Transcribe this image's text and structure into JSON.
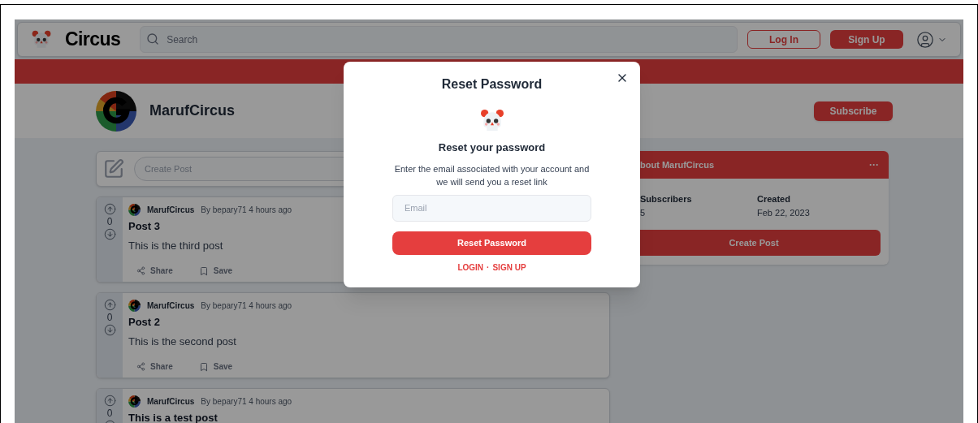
{
  "navbar": {
    "logo": "Circus",
    "search": {
      "placeholder": "Search"
    },
    "buttons": [
      "Log In",
      "Sign Up"
    ]
  },
  "community": {
    "name": "MarufCircus",
    "subscribe": "Subscribe"
  },
  "create_post": {
    "placeholder": "Create Post"
  },
  "posts": [
    {
      "votes": "0",
      "community": "MarufCircus",
      "meta": "By bepary71 4 hours ago",
      "title": "Post 3",
      "body": "This is the third post",
      "actions": [
        "Share",
        "Save"
      ]
    },
    {
      "votes": "0",
      "community": "MarufCircus",
      "meta": "By bepary71 4 hours ago",
      "title": "Post 2",
      "body": "This is the second post",
      "actions": [
        "Share",
        "Save"
      ]
    },
    {
      "votes": "0",
      "community": "MarufCircus",
      "meta": "By bepary71 4 hours ago",
      "title": "This is a test post"
    }
  ],
  "about": {
    "title": "bout MarufCircus",
    "more": "···",
    "stats": [
      {
        "label": "Subscribers",
        "value": "5"
      },
      {
        "label": "Created",
        "value": "Feb 22, 2023"
      }
    ],
    "button": "Create Post"
  },
  "modal": {
    "title": "Reset Password",
    "heading": "Reset your password",
    "text": "Enter the email associated with your account and we will send you a reset link",
    "email": {
      "placeholder": "Email"
    },
    "submit": "Reset Password",
    "links": [
      "LOGIN",
      "SIGN UP"
    ],
    "separator": "·"
  }
}
